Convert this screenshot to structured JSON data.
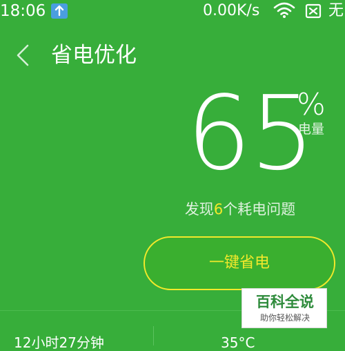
{
  "status_bar": {
    "time": "18:06",
    "net_speed": "0.00K/s",
    "carrier": "无"
  },
  "header": {
    "title": "省电优化"
  },
  "battery": {
    "value": "65",
    "unit": "%",
    "label": "电量"
  },
  "issues": {
    "prefix": "发现",
    "count": "6",
    "suffix": "个耗电问题"
  },
  "actions": {
    "save_label": "一键省电"
  },
  "bottom": {
    "left_text": "12小时27分钟",
    "right_text": "35°C"
  },
  "watermark": {
    "main": "百科全说",
    "sub": "助你轻松解决"
  },
  "colors": {
    "background": "#37ae3a",
    "accent_yellow": "#f2e92b"
  },
  "icons": [
    "upload-icon",
    "wifi-icon",
    "sim-icon",
    "back-icon"
  ]
}
